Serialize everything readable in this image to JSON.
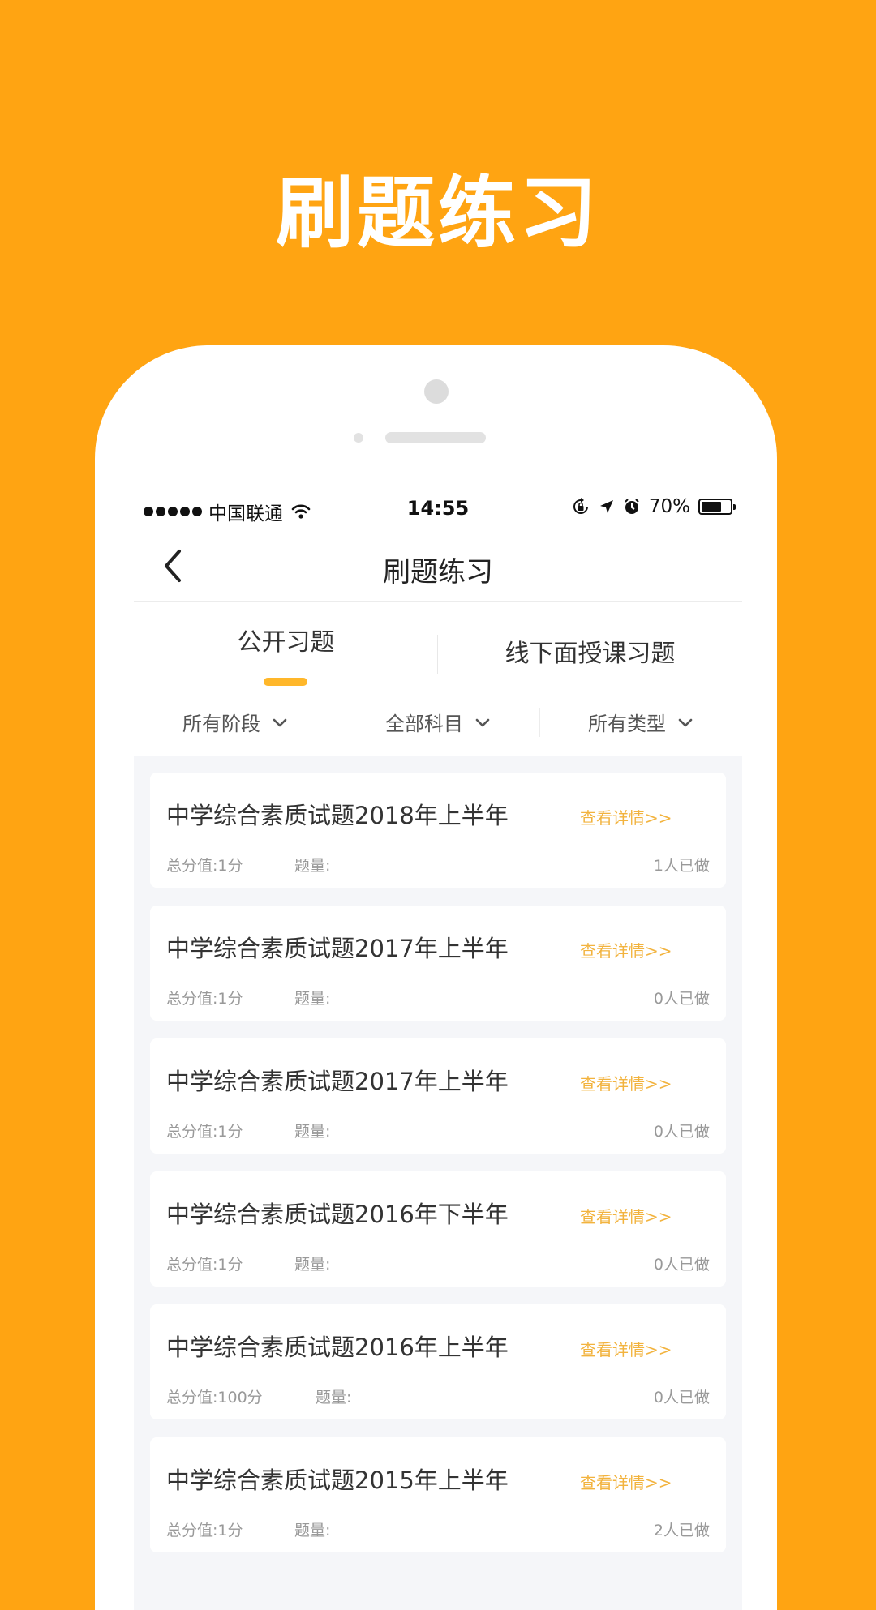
{
  "promo": {
    "title": "刷题练习"
  },
  "status_bar": {
    "carrier": "中国联通",
    "time": "14:55",
    "battery": "70%",
    "battery_level": 0.7
  },
  "nav": {
    "title": "刷题练习"
  },
  "tabs": [
    {
      "label": "公开习题",
      "active": true
    },
    {
      "label": "线下面授课习题",
      "active": false
    }
  ],
  "filters": [
    {
      "label": "所有阶段"
    },
    {
      "label": "全部科目"
    },
    {
      "label": "所有类型"
    }
  ],
  "exams": [
    {
      "title": "中学综合素质试题2018年上半年",
      "link": "查看详情>>",
      "score": "总分值:1分",
      "qcount": "题量:",
      "done": "1人已做"
    },
    {
      "title": "中学综合素质试题2017年上半年",
      "link": "查看详情>>",
      "score": "总分值:1分",
      "qcount": "题量:",
      "done": "0人已做"
    },
    {
      "title": "中学综合素质试题2017年上半年",
      "link": "查看详情>>",
      "score": "总分值:1分",
      "qcount": "题量:",
      "done": "0人已做"
    },
    {
      "title": "中学综合素质试题2016年下半年",
      "link": "查看详情>>",
      "score": "总分值:1分",
      "qcount": "题量:",
      "done": "0人已做"
    },
    {
      "title": "中学综合素质试题2016年上半年",
      "link": "查看详情>>",
      "score": "总分值:100分",
      "qcount": "题量:",
      "done": "0人已做"
    },
    {
      "title": "中学综合素质试题2015年上半年",
      "link": "查看详情>>",
      "score": "总分值:1分",
      "qcount": "题量:",
      "done": "2人已做"
    }
  ]
}
